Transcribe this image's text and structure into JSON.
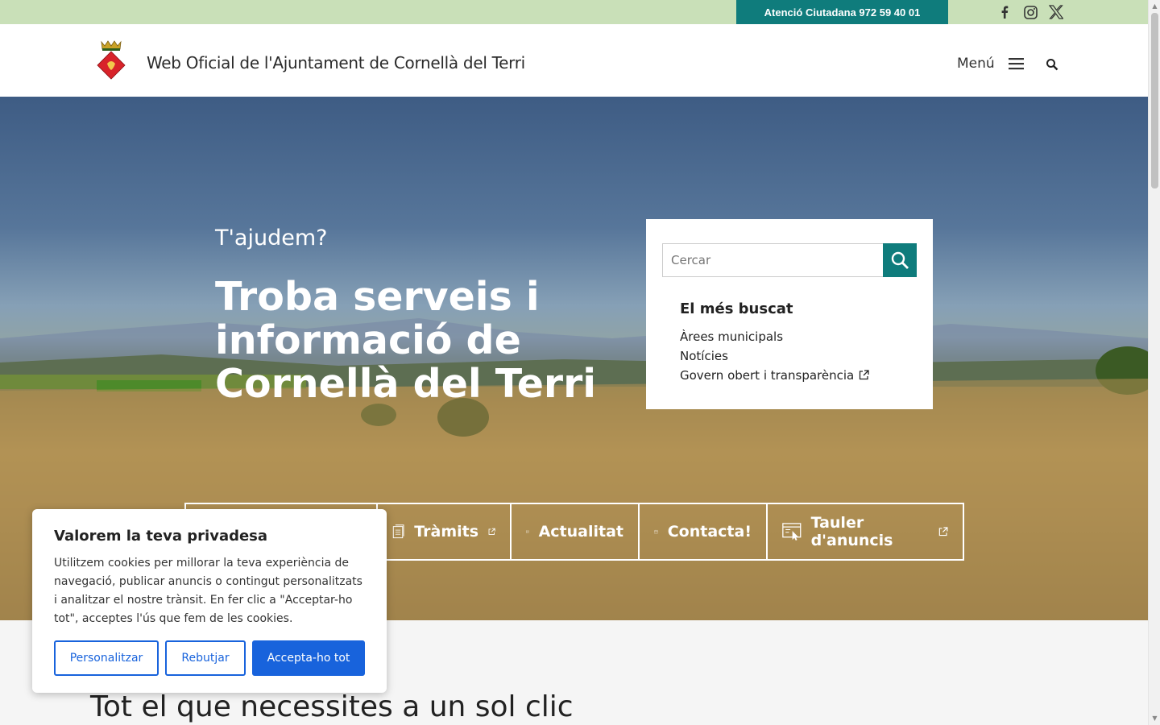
{
  "topbar": {
    "atencio": "Atenció Ciutadana 972 59 40 01",
    "socials": [
      "facebook-icon",
      "instagram-icon",
      "x-twitter-icon"
    ]
  },
  "header": {
    "title": "Web Oficial de l'Ajuntament de Cornellà del Terri",
    "menu_label": "Menú"
  },
  "hero": {
    "subtitle": "T'ajudem?",
    "title": "Troba serveis i informació de Cornellà del Terri",
    "search_placeholder": "Cercar",
    "mes_buscat_title": "El més buscat",
    "mes_buscat_links": [
      "Àrees municipals",
      "Notícies",
      "Govern obert i transparència"
    ]
  },
  "quick_links": [
    {
      "label": "Tràmits",
      "icon": "document-icon",
      "external": true
    },
    {
      "label": "Actualitat",
      "icon": "calendar-grid-icon",
      "external": false
    },
    {
      "label": "Contacta!",
      "icon": "calendar-check-icon",
      "external": false
    },
    {
      "label": "Tauler d'anuncis",
      "icon": "board-click-icon",
      "external": true
    }
  ],
  "cookie": {
    "title": "Valorem la teva privadesa",
    "text": "Utilitzem cookies per millorar la teva experiència de navegació, publicar anuncis o contingut personalitzats i analitzar el nostre trànsit. En fer clic a \"Acceptar-ho tot\", acceptes l'ús que fem de les cookies.",
    "customize": "Personalitzar",
    "reject": "Rebutjar",
    "accept": "Accepta-ho tot"
  },
  "section": {
    "title": "Tot el que necessites a un sol clic"
  },
  "colors": {
    "topbar": "#c9e0b8",
    "teal": "#0f7c7c",
    "cookie_blue": "#1863dc"
  }
}
